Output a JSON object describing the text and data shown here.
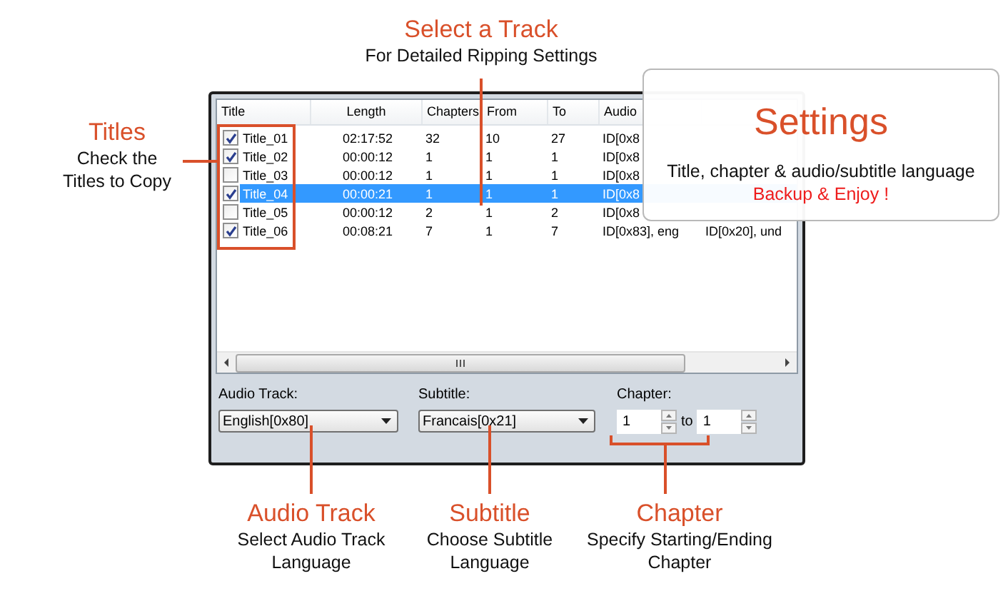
{
  "annotations": {
    "select_track": {
      "title": "Select a Track",
      "text": "For Detailed Ripping Settings"
    },
    "titles": {
      "title": "Titles",
      "text": "Check the Titles to Copy"
    },
    "audio_track": {
      "title": "Audio Track",
      "text": "Select Audio Track Language"
    },
    "subtitle": {
      "title": "Subtitle",
      "text": "Choose Subtitle Language"
    },
    "chapter": {
      "title": "Chapter",
      "text": "Specify Starting/Ending Chapter"
    }
  },
  "window": {
    "table": {
      "columns": [
        "Title",
        "Length",
        "Chapters",
        "From",
        "To",
        "Audio"
      ],
      "rows": [
        {
          "checked": true,
          "selected": false,
          "cells": [
            "Title_01",
            "02:17:52",
            "32",
            "10",
            "27",
            "ID[0x8"
          ]
        },
        {
          "checked": true,
          "selected": false,
          "cells": [
            "Title_02",
            "00:00:12",
            "1",
            "1",
            "1",
            "ID[0x8"
          ]
        },
        {
          "checked": false,
          "selected": false,
          "cells": [
            "Title_03",
            "00:00:12",
            "1",
            "1",
            "1",
            "ID[0x8"
          ]
        },
        {
          "checked": true,
          "selected": true,
          "cells": [
            "Title_04",
            "00:00:21",
            "1",
            "1",
            "1",
            "ID[0x8"
          ]
        },
        {
          "checked": false,
          "selected": false,
          "cells": [
            "Title_05",
            "00:00:12",
            "2",
            "1",
            "2",
            "ID[0x8"
          ]
        },
        {
          "checked": true,
          "selected": false,
          "cells": [
            "Title_06",
            "00:08:21",
            "7",
            "1",
            "7",
            "ID[0x83], eng",
            "ID[0x20], und"
          ]
        }
      ]
    },
    "audio_track": {
      "label": "Audio Track:",
      "value": "English[0x80]"
    },
    "subtitle": {
      "label": "Subtitle:",
      "value": "Francais[0x21]"
    },
    "chapter": {
      "label": "Chapter:",
      "from": "1",
      "separator": "to",
      "to": "1"
    }
  },
  "callout": {
    "title": "Settings",
    "text": "Title, chapter & audio/subtitle language",
    "tagline": "Backup & Enjoy !"
  }
}
